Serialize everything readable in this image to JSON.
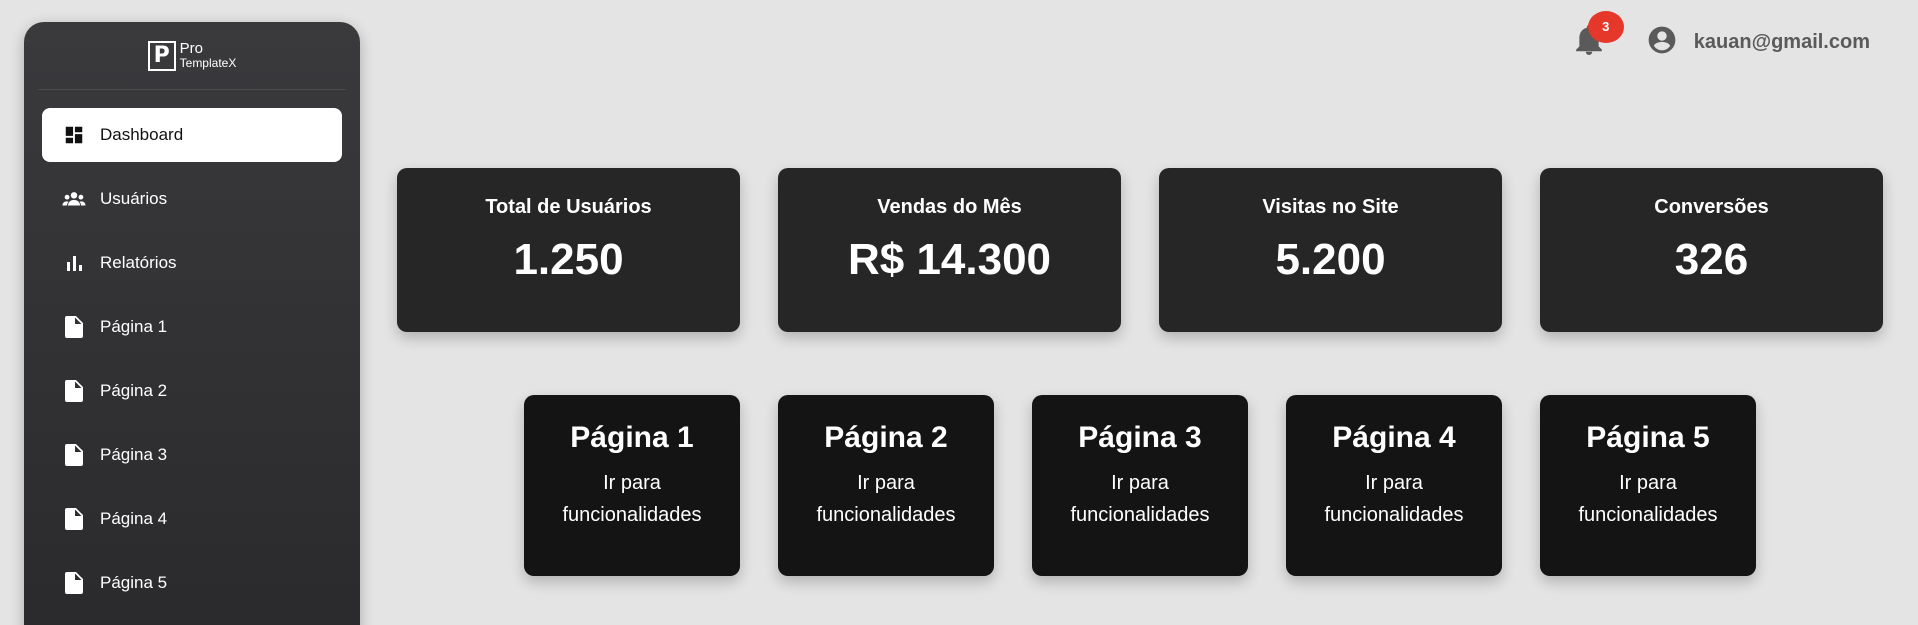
{
  "logo": {
    "mark": "P",
    "line1": "Pro",
    "line2": "TemplateX"
  },
  "sidebar": {
    "items": [
      {
        "label": "Dashboard",
        "icon": "dashboard-icon"
      },
      {
        "label": "Usuários",
        "icon": "users-icon"
      },
      {
        "label": "Relatórios",
        "icon": "bar-chart-icon"
      },
      {
        "label": "Página 1",
        "icon": "document-icon"
      },
      {
        "label": "Página 2",
        "icon": "document-icon"
      },
      {
        "label": "Página 3",
        "icon": "document-icon"
      },
      {
        "label": "Página 4",
        "icon": "document-icon"
      },
      {
        "label": "Página 5",
        "icon": "document-icon"
      }
    ]
  },
  "header": {
    "notification_count": "3",
    "user_email": "kauan@gmail.com"
  },
  "stats": [
    {
      "title": "Total de Usuários",
      "value": "1.250"
    },
    {
      "title": "Vendas do Mês",
      "value": "R$ 14.300"
    },
    {
      "title": "Visitas no Site",
      "value": "5.200"
    },
    {
      "title": "Conversões",
      "value": "326"
    }
  ],
  "pages": [
    {
      "title": "Página 1",
      "subtitle": "Ir para funcionalidades"
    },
    {
      "title": "Página 2",
      "subtitle": "Ir para funcionalidades"
    },
    {
      "title": "Página 3",
      "subtitle": "Ir para funcionalidades"
    },
    {
      "title": "Página 4",
      "subtitle": "Ir para funcionalidades"
    },
    {
      "title": "Página 5",
      "subtitle": "Ir para funcionalidades"
    }
  ],
  "colors": {
    "background": "#e4e4e4",
    "sidebar": "#333335",
    "stat_card": "#262626",
    "page_card": "#141414",
    "badge": "#e5372a"
  }
}
